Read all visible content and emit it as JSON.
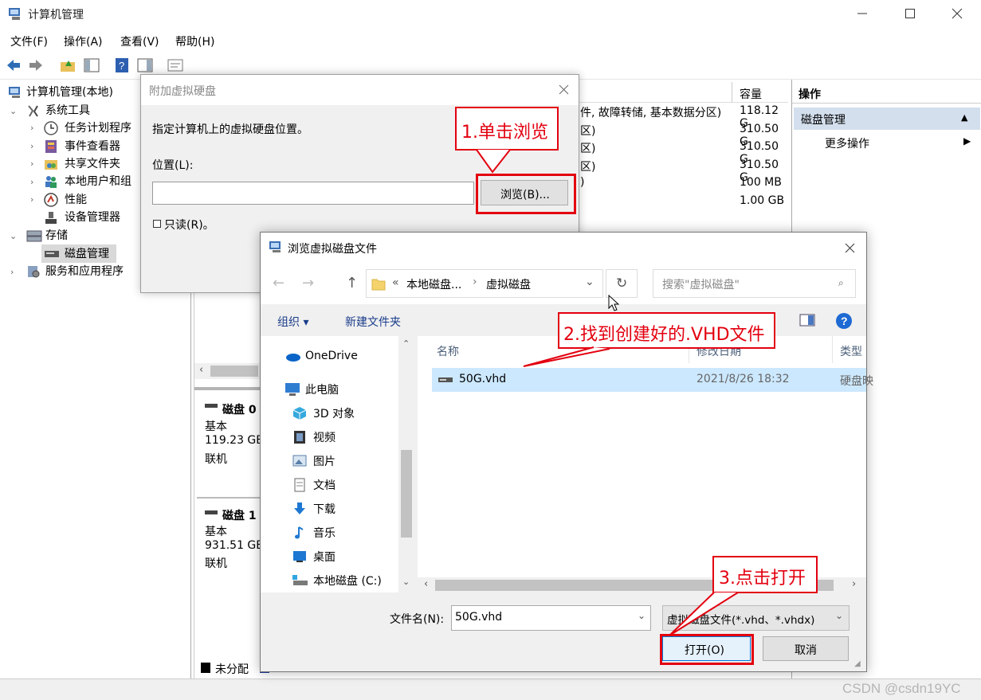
{
  "window": {
    "title": "计算机管理",
    "controls": [
      "minimize",
      "maximize",
      "close"
    ]
  },
  "menu": [
    "文件(F)",
    "操作(A)",
    "查看(V)",
    "帮助(H)"
  ],
  "tree": {
    "root": "计算机管理(本地)",
    "system_tools": "系统工具",
    "items": [
      "任务计划程序",
      "事件查看器",
      "共享文件夹",
      "本地用户和组",
      "性能",
      "设备管理器"
    ],
    "storage": "存储",
    "disk_mgmt": "磁盘管理",
    "services": "服务和应用程序"
  },
  "volume_table": {
    "capacity_header": "容量",
    "rows": [
      {
        "status": "件, 故障转储, 基本数据分区)",
        "capacity": "118.12 G"
      },
      {
        "status": "区)",
        "capacity": "310.50 G"
      },
      {
        "status": "区)",
        "capacity": "310.50 G"
      },
      {
        "status": "区)",
        "capacity": "310.50 G"
      },
      {
        "status": ")",
        "capacity": "100 MB"
      },
      {
        "status": "",
        "capacity": "1.00 GB"
      }
    ]
  },
  "disks": [
    {
      "name": "磁盘 0",
      "type": "基本",
      "size": "119.23 GB",
      "state": "联机"
    },
    {
      "name": "磁盘 1",
      "type": "基本",
      "size": "931.51 GB",
      "state": "联机"
    }
  ],
  "legend": {
    "unallocated": "未分配"
  },
  "actions": {
    "header": "操作",
    "section": "磁盘管理",
    "more": "更多操作"
  },
  "dialog_attach": {
    "title": "附加虚拟硬盘",
    "prompt": "指定计算机上的虚拟硬盘位置。",
    "location_label": "位置(L):",
    "location_value": "",
    "browse_button": "浏览(B)...",
    "readonly_label": "只读(R)。"
  },
  "dialog_browse": {
    "title": "浏览虚拟磁盘文件",
    "path_segments": [
      "«",
      "本地磁盘...",
      "›",
      "虚拟磁盘"
    ],
    "search_placeholder": "搜索\"虚拟磁盘\"",
    "organize": "组织 ▾",
    "new_folder": "新建文件夹",
    "nav_items": [
      "OneDrive",
      "此电脑",
      "3D 对象",
      "视频",
      "图片",
      "文档",
      "下载",
      "音乐",
      "桌面",
      "本地磁盘 (C:)"
    ],
    "columns": [
      "名称",
      "修改日期",
      "类型"
    ],
    "files": [
      {
        "name": "50G.vhd",
        "modified": "2021/8/26 18:32",
        "type": "硬盘映"
      }
    ],
    "filename_label": "文件名(N):",
    "filename_value": "50G.vhd",
    "filter_value": "虚拟磁盘文件(*.vhd、*.vhdx)",
    "open_button": "打开(O)",
    "cancel_button": "取消"
  },
  "annotations": [
    "1.单击浏览",
    "2.找到创建好的.VHD文件",
    "3.点击打开"
  ],
  "watermark": "CSDN @csdn19YC",
  "colors": {
    "annotation": "#e3000f",
    "selection": "#cce8ff",
    "accent": "#0078d7"
  }
}
